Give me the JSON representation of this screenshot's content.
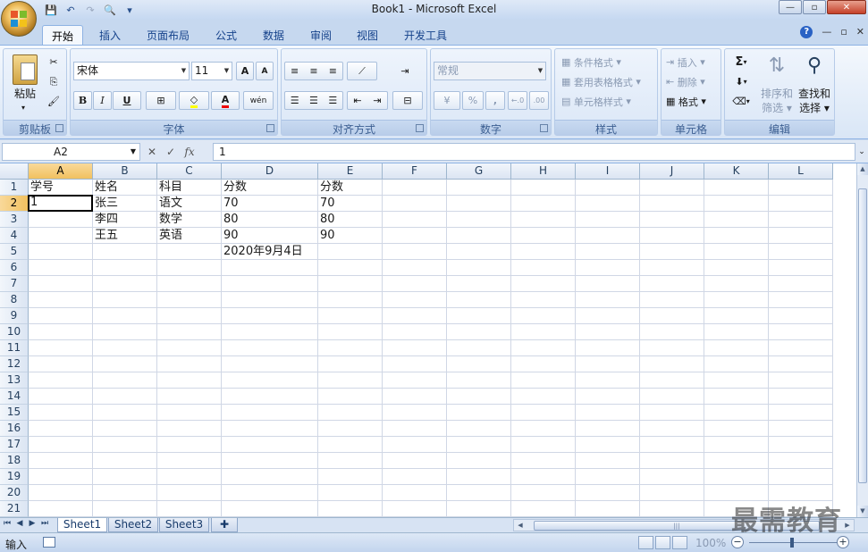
{
  "window": {
    "title": "Book1 - Microsoft Excel",
    "minimize": "—",
    "restore": "▫",
    "close": "✕",
    "doc_minimize": "—",
    "doc_restore": "▫",
    "doc_close": "✕"
  },
  "quick_access": [
    "💾",
    "↶",
    "↷",
    "🔍",
    "▾"
  ],
  "tabs": [
    "开始",
    "插入",
    "页面布局",
    "公式",
    "数据",
    "审阅",
    "视图",
    "开发工具"
  ],
  "active_tab": "开始",
  "ribbon": {
    "clipboard": {
      "label": "剪贴板",
      "paste": "粘贴"
    },
    "font": {
      "label": "字体",
      "font_name": "宋体",
      "font_size": "11",
      "grow": "A",
      "shrink": "A",
      "bold": "B",
      "italic": "I",
      "underline": "U",
      "font_color": "A",
      "phonetic": "wén"
    },
    "alignment": {
      "label": "对齐方式"
    },
    "number": {
      "label": "数字",
      "format": "常规",
      "percent": "%",
      "comma": ",",
      "inc_decimal": "←.0",
      "dec_decimal": ".00"
    },
    "styles": {
      "label": "样式",
      "conditional": "条件格式",
      "table_format": "套用表格格式",
      "cell_styles": "单元格样式"
    },
    "cells": {
      "label": "单元格",
      "insert": "插入",
      "delete": "删除",
      "format": "格式"
    },
    "editing": {
      "label": "编辑",
      "sum": "Σ",
      "sort_line1": "排序和",
      "sort_line2": "筛选",
      "find_line1": "查找和",
      "find_line2": "选择"
    }
  },
  "formula_bar": {
    "name_box": "A2",
    "cancel": "✕",
    "enter": "✓",
    "fx": "fx",
    "content": "1"
  },
  "columns": [
    "A",
    "B",
    "C",
    "D",
    "E",
    "F",
    "G",
    "H",
    "I",
    "J",
    "K",
    "L"
  ],
  "rows": [
    "1",
    "2",
    "3",
    "4",
    "5",
    "6",
    "7",
    "8",
    "9",
    "10",
    "11",
    "12",
    "13",
    "14",
    "15",
    "16",
    "17",
    "18",
    "19",
    "20",
    "21"
  ],
  "cells": {
    "A1": "学号",
    "B1": "姓名",
    "C1": "科目",
    "D1": "分数",
    "E1": "分数",
    "A2": "1",
    "B2": "张三",
    "C2": "语文",
    "D2": "70",
    "E2": "70",
    "B3": "李四",
    "C3": "数学",
    "D3": "80",
    "E3": "80",
    "B4": "王五",
    "C4": "英语",
    "D4": "90",
    "E4": "90",
    "D5": "2020年9月4日"
  },
  "active_cell": "A2",
  "sheets": [
    "Sheet1",
    "Sheet2",
    "Sheet3"
  ],
  "active_sheet": "Sheet1",
  "status": {
    "mode": "输入",
    "zoom": "100%",
    "zoom_minus": "−",
    "zoom_plus": "+"
  },
  "watermark": "最需教育"
}
